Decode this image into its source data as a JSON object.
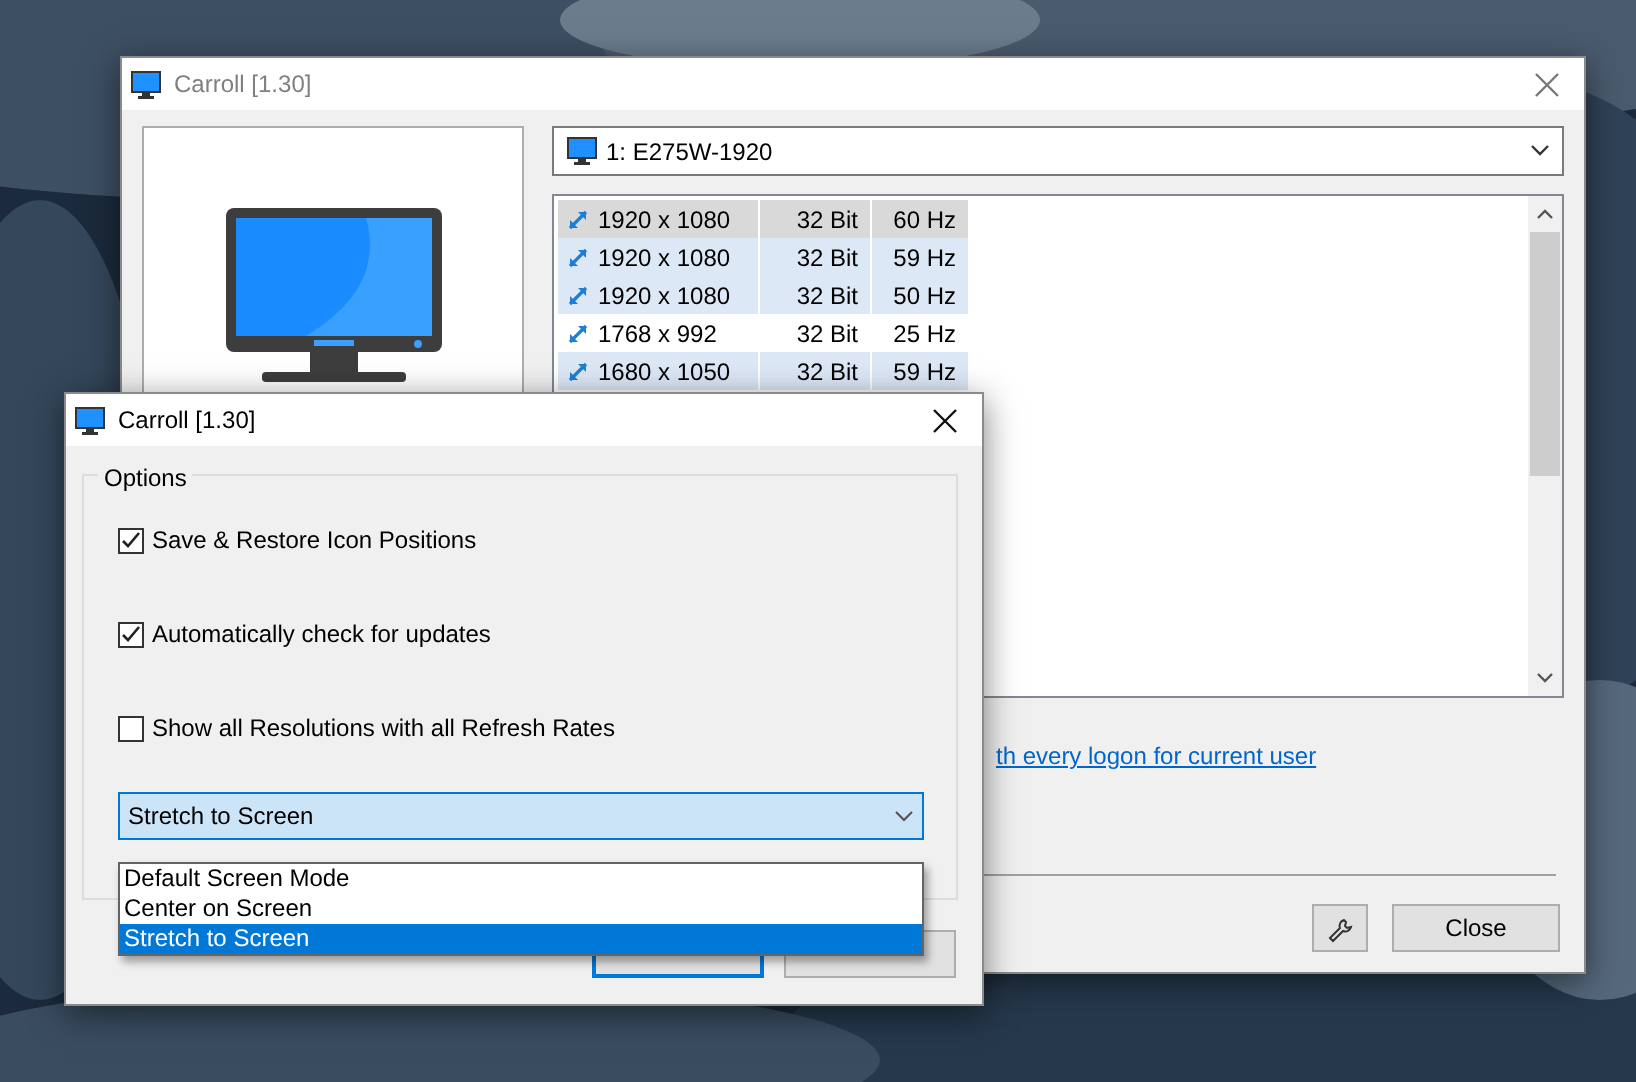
{
  "main_window": {
    "title": "Carroll [1.30]",
    "monitor_select": {
      "value": "1: E275W-1920"
    },
    "modes": [
      {
        "resolution": "1920 x 1080",
        "depth": "32 Bit",
        "refresh": "60 Hz",
        "selected": true,
        "highlighted": false
      },
      {
        "resolution": "1920 x 1080",
        "depth": "32 Bit",
        "refresh": "59 Hz",
        "selected": false,
        "highlighted": true
      },
      {
        "resolution": "1920 x 1080",
        "depth": "32 Bit",
        "refresh": "50 Hz",
        "selected": false,
        "highlighted": true
      },
      {
        "resolution": "1768 x 992",
        "depth": "32 Bit",
        "refresh": "25 Hz",
        "selected": false,
        "highlighted": false
      },
      {
        "resolution": "1680 x 1050",
        "depth": "32 Bit",
        "refresh": "59 Hz",
        "selected": false,
        "highlighted": true
      }
    ],
    "link": "th every logon for current user",
    "close_button": "Close"
  },
  "options_dialog": {
    "title": "Carroll [1.30]",
    "group": "Options",
    "options": [
      {
        "label": "Save & Restore Icon Positions",
        "checked": true
      },
      {
        "label": "Automatically check for updates",
        "checked": true
      },
      {
        "label": "Show all Resolutions with all Refresh Rates",
        "checked": false
      }
    ],
    "screen_mode": {
      "value": "Stretch to Screen",
      "expanded": true,
      "options": [
        {
          "label": "Default Screen Mode",
          "selected": false
        },
        {
          "label": "Center on Screen",
          "selected": false
        },
        {
          "label": "Stretch to Screen",
          "selected": true
        }
      ]
    },
    "buttons": [
      {
        "default": true
      },
      {
        "default": false
      }
    ]
  }
}
